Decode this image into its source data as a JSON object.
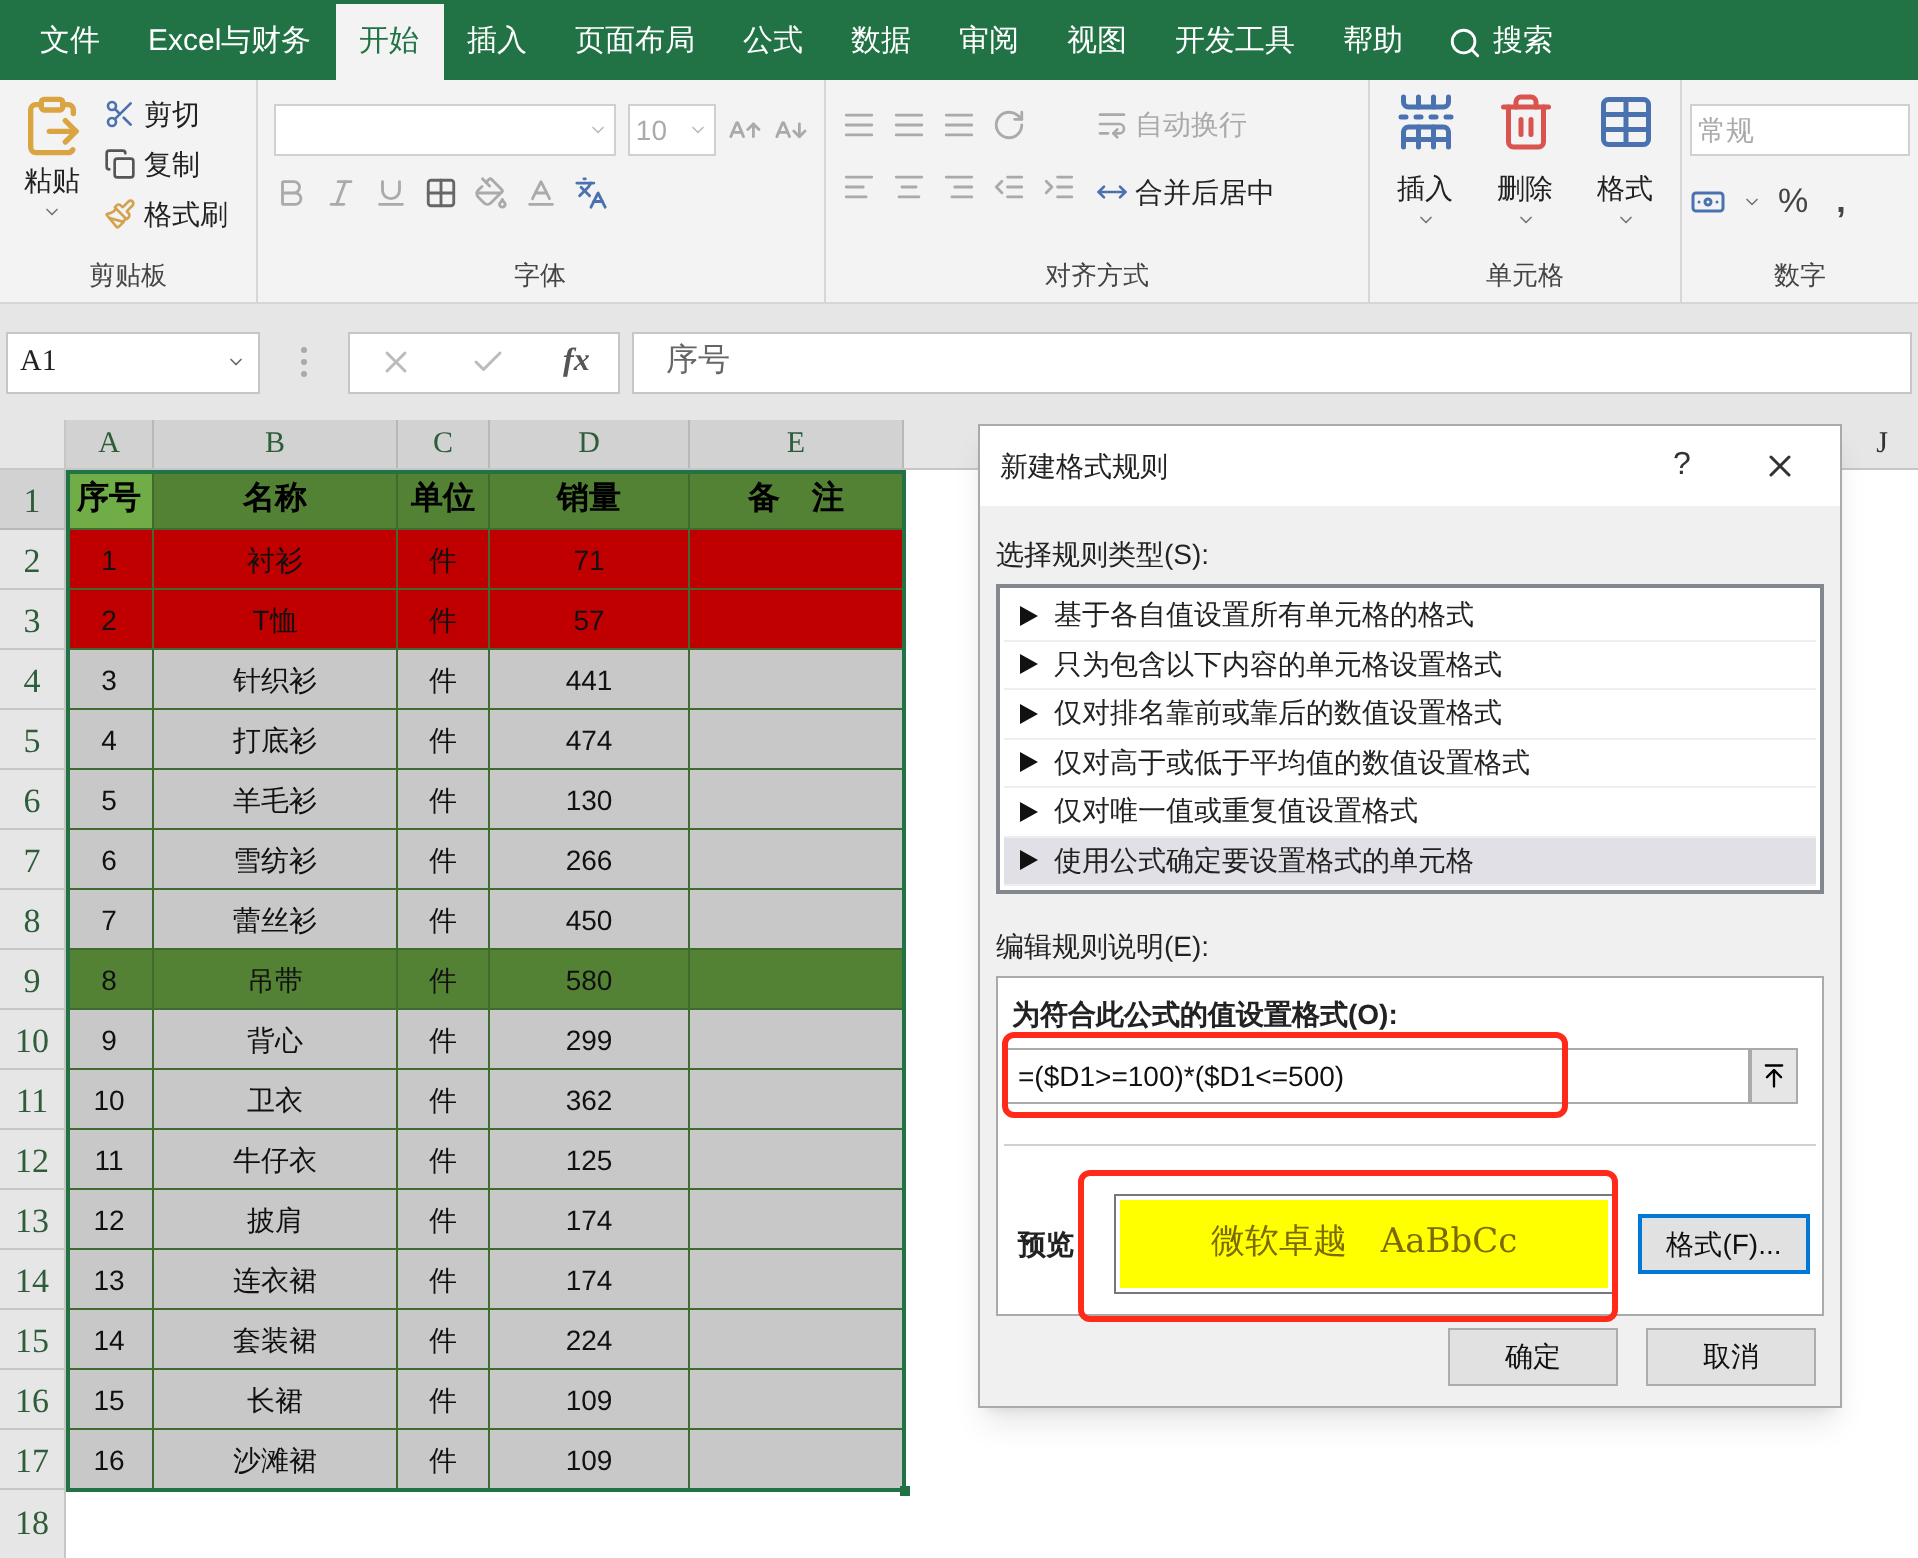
{
  "menu_tabs": [
    {
      "label": "文件",
      "selected": false
    },
    {
      "label": "Excel与财务",
      "selected": false
    },
    {
      "label": "开始",
      "selected": true
    },
    {
      "label": "插入",
      "selected": false
    },
    {
      "label": "页面布局",
      "selected": false
    },
    {
      "label": "公式",
      "selected": false
    },
    {
      "label": "数据",
      "selected": false
    },
    {
      "label": "审阅",
      "selected": false
    },
    {
      "label": "视图",
      "selected": false
    },
    {
      "label": "开发工具",
      "selected": false
    },
    {
      "label": "帮助",
      "selected": false
    }
  ],
  "search": {
    "label": "搜索"
  },
  "ribbon": {
    "clipboard": {
      "title": "剪贴板",
      "paste": "粘贴",
      "items": [
        {
          "kind": "cut",
          "label": "剪切"
        },
        {
          "kind": "copy",
          "label": "复制"
        },
        {
          "kind": "painter",
          "label": "格式刷"
        }
      ]
    },
    "font": {
      "title": "字体",
      "size": "10"
    },
    "alignment": {
      "title": "对齐方式",
      "buttons": [
        {
          "kind": "wrap",
          "label": "自动换行",
          "disabled": true
        },
        {
          "kind": "merge",
          "label": "合并后居中",
          "disabled": false
        }
      ]
    },
    "cells": {
      "title": "单元格",
      "buttons": [
        {
          "kind": "insert",
          "label": "插入"
        },
        {
          "kind": "delete",
          "label": "删除"
        },
        {
          "kind": "format",
          "label": "格式"
        }
      ]
    },
    "number": {
      "title": "数字",
      "format": "常规",
      "percent": "%",
      "comma": ","
    }
  },
  "formula_bar": {
    "name_box": "A1",
    "fx": "fx",
    "value": "序号"
  },
  "sheet": {
    "columns": [
      "A",
      "B",
      "C",
      "D",
      "E"
    ],
    "far_column": "J",
    "header": {
      "row": "1",
      "color": "#548235",
      "cells": [
        {
          "text": "序号",
          "selected": true
        },
        {
          "text": "名称",
          "selected": false
        },
        {
          "text": "单位",
          "selected": false
        },
        {
          "text": "销量",
          "selected": false
        },
        {
          "text": "备　注",
          "selected": false
        }
      ]
    },
    "rows": [
      {
        "row": "2",
        "color": "#c00000",
        "cells": [
          "1",
          "衬衫",
          "件",
          "71"
        ]
      },
      {
        "row": "3",
        "color": "#c00000",
        "cells": [
          "2",
          "T恤",
          "件",
          "57"
        ]
      },
      {
        "row": "4",
        "color": "#c8c8c8",
        "cells": [
          "3",
          "针织衫",
          "件",
          "441"
        ]
      },
      {
        "row": "5",
        "color": "#c8c8c8",
        "cells": [
          "4",
          "打底衫",
          "件",
          "474"
        ]
      },
      {
        "row": "6",
        "color": "#c8c8c8",
        "cells": [
          "5",
          "羊毛衫",
          "件",
          "130"
        ]
      },
      {
        "row": "7",
        "color": "#c8c8c8",
        "cells": [
          "6",
          "雪纺衫",
          "件",
          "266"
        ]
      },
      {
        "row": "8",
        "color": "#c8c8c8",
        "cells": [
          "7",
          "蕾丝衫",
          "件",
          "450"
        ]
      },
      {
        "row": "9",
        "color": "#548235",
        "cells": [
          "8",
          "吊带",
          "件",
          "580"
        ]
      },
      {
        "row": "10",
        "color": "#c8c8c8",
        "cells": [
          "9",
          "背心",
          "件",
          "299"
        ]
      },
      {
        "row": "11",
        "color": "#c8c8c8",
        "cells": [
          "10",
          "卫衣",
          "件",
          "362"
        ]
      },
      {
        "row": "12",
        "color": "#c8c8c8",
        "cells": [
          "11",
          "牛仔衣",
          "件",
          "125"
        ]
      },
      {
        "row": "13",
        "color": "#c8c8c8",
        "cells": [
          "12",
          "披肩",
          "件",
          "174"
        ]
      },
      {
        "row": "14",
        "color": "#c8c8c8",
        "cells": [
          "13",
          "连衣裙",
          "件",
          "174"
        ]
      },
      {
        "row": "15",
        "color": "#c8c8c8",
        "cells": [
          "14",
          "套装裙",
          "件",
          "224"
        ]
      },
      {
        "row": "16",
        "color": "#c8c8c8",
        "cells": [
          "15",
          "长裙",
          "件",
          "109"
        ]
      },
      {
        "row": "17",
        "color": "#c8c8c8",
        "cells": [
          "16",
          "沙滩裙",
          "件",
          "109"
        ]
      }
    ],
    "empty_rows": [
      "18"
    ]
  },
  "dialog": {
    "title": "新建格式规则",
    "help": "?",
    "rule_type_label": "选择规则类型(S):",
    "rule_types": [
      {
        "label": "基于各自值设置所有单元格的格式",
        "selected": false
      },
      {
        "label": "只为包含以下内容的单元格设置格式",
        "selected": false
      },
      {
        "label": "仅对排名靠前或靠后的数值设置格式",
        "selected": false
      },
      {
        "label": "仅对高于或低于平均值的数值设置格式",
        "selected": false
      },
      {
        "label": "仅对唯一值或重复值设置格式",
        "selected": false
      },
      {
        "label": "使用公式确定要设置格式的单元格",
        "selected": true
      }
    ],
    "description_label": "编辑规则说明(E):",
    "formula_label": "为符合此公式的值设置格式(O):",
    "formula": "=($D1>=100)*($D1<=500)",
    "preview_label": "预览",
    "preview_text": "微软卓越　AaBbCc",
    "format_button": "格式(F)...",
    "ok": "确定",
    "cancel": "取消"
  }
}
